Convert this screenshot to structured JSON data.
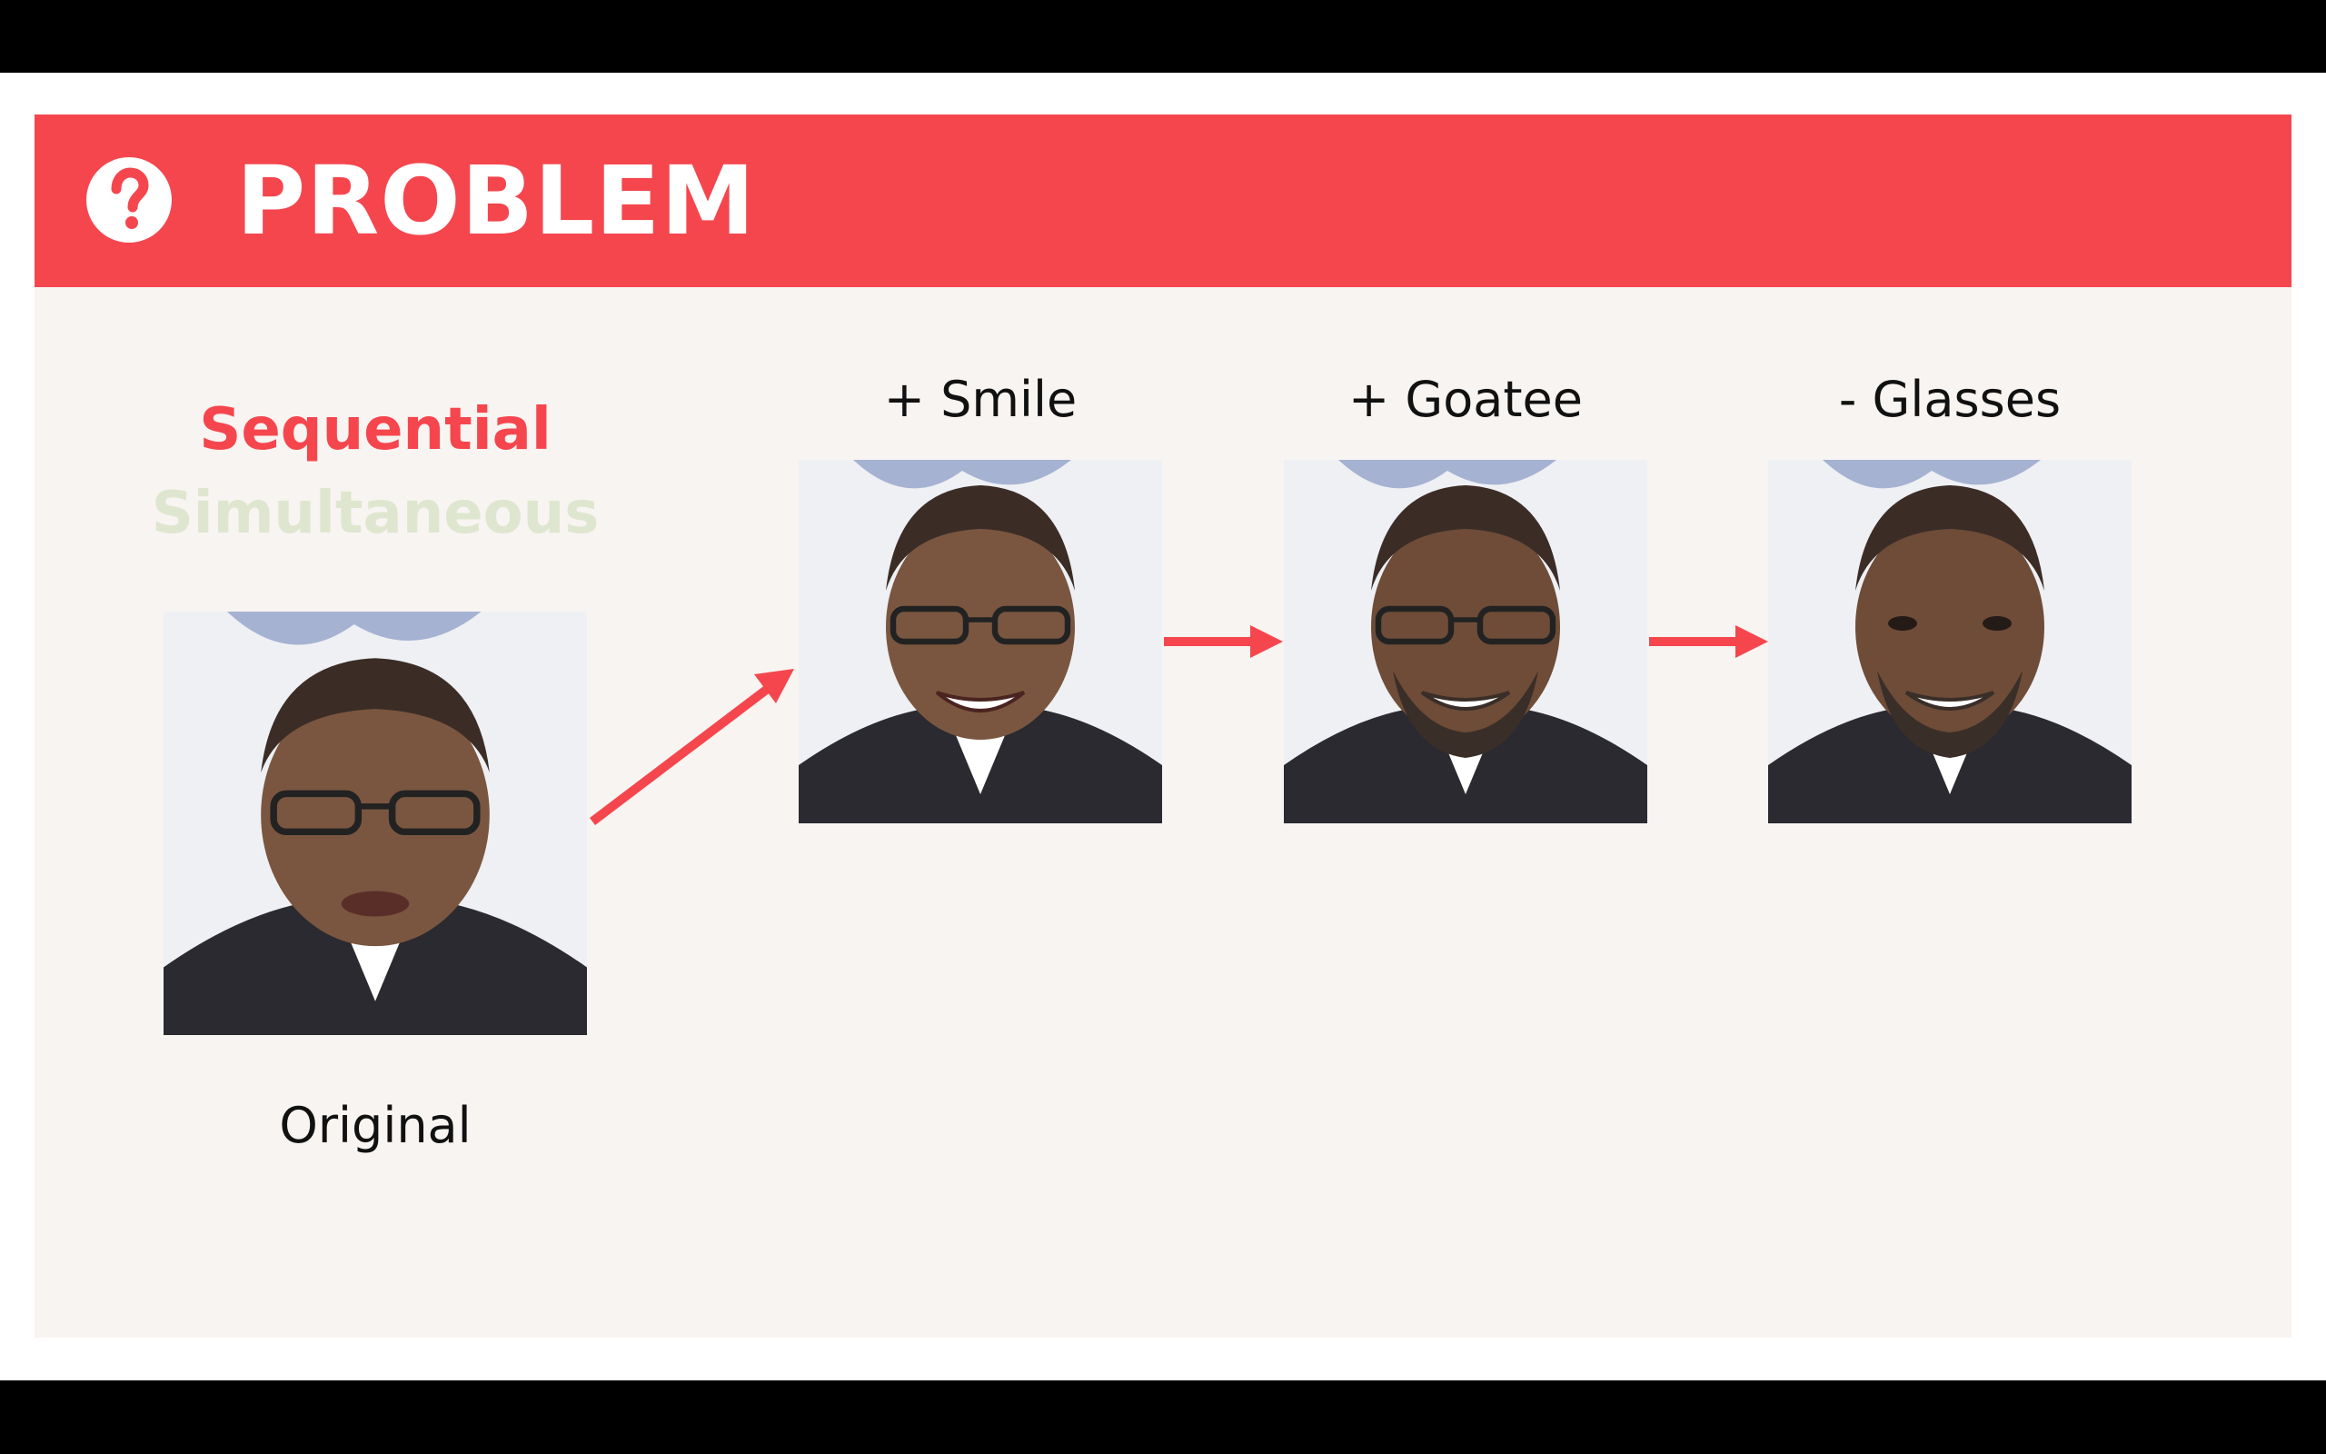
{
  "slide": {
    "title": "PROBLEM",
    "mode_active": "Sequential",
    "mode_inactive": "Simultaneous"
  },
  "faces": {
    "original": {
      "label": "Original"
    },
    "smile": {
      "label": "+ Smile"
    },
    "goatee": {
      "label": "+ Goatee"
    },
    "glasses": {
      "label": "- Glasses"
    }
  },
  "colors": {
    "accent": "#f5464e",
    "background": "#f8f4f1",
    "inactive": "#dfe6cf"
  },
  "icons": {
    "header": "question-circle-icon"
  }
}
